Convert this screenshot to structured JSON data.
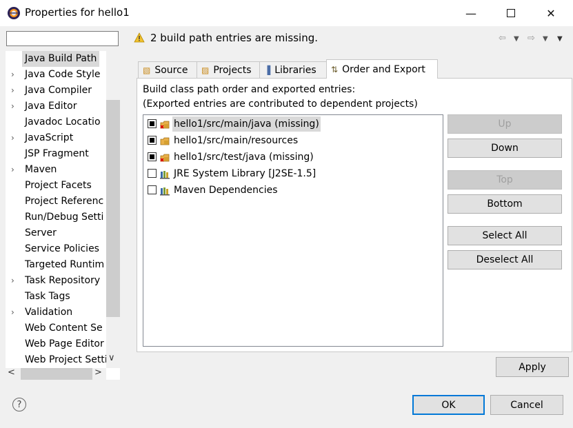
{
  "window": {
    "title": "Properties for hello1"
  },
  "filter": {
    "value": ""
  },
  "tree": {
    "items": [
      {
        "label": "Java Build Path",
        "expandable": false,
        "selected": true
      },
      {
        "label": "Java Code Style",
        "expandable": true
      },
      {
        "label": "Java Compiler",
        "expandable": true
      },
      {
        "label": "Java Editor",
        "expandable": true
      },
      {
        "label": "Javadoc Locatio",
        "expandable": false
      },
      {
        "label": "JavaScript",
        "expandable": true
      },
      {
        "label": "JSP Fragment",
        "expandable": false
      },
      {
        "label": "Maven",
        "expandable": true
      },
      {
        "label": "Project Facets",
        "expandable": false
      },
      {
        "label": "Project Referenc",
        "expandable": false
      },
      {
        "label": "Run/Debug Setti",
        "expandable": false
      },
      {
        "label": "Server",
        "expandable": false
      },
      {
        "label": "Service Policies",
        "expandable": false
      },
      {
        "label": "Targeted Runtim",
        "expandable": false
      },
      {
        "label": "Task Repository",
        "expandable": true
      },
      {
        "label": "Task Tags",
        "expandable": false
      },
      {
        "label": "Validation",
        "expandable": true
      },
      {
        "label": "Web Content Se",
        "expandable": false
      },
      {
        "label": "Web Page Editor",
        "expandable": false
      },
      {
        "label": "Web Project Setti",
        "expandable": false
      }
    ]
  },
  "header": {
    "message": "2 build path entries are missing."
  },
  "tabs": [
    {
      "label": "Source",
      "icon": "source-folder-icon"
    },
    {
      "label": "Projects",
      "icon": "projects-folder-icon"
    },
    {
      "label": "Libraries",
      "icon": "libraries-icon"
    },
    {
      "label": "Order and Export",
      "icon": "order-export-icon",
      "active": true
    }
  ],
  "panel": {
    "description_line1": "Build class path order and exported entries:",
    "description_line2": "(Exported entries are contributed to dependent projects)"
  },
  "entries": [
    {
      "label": "hello1/src/main/java (missing)",
      "checked": true,
      "selected": true,
      "icon": "missing-source-folder-icon"
    },
    {
      "label": "hello1/src/main/resources",
      "checked": true,
      "icon": "source-folder-icon"
    },
    {
      "label": "hello1/src/test/java (missing)",
      "checked": true,
      "icon": "missing-source-folder-icon"
    },
    {
      "label": "JRE System Library [J2SE-1.5]",
      "checked": false,
      "icon": "library-icon"
    },
    {
      "label": "Maven Dependencies",
      "checked": false,
      "icon": "library-icon"
    }
  ],
  "buttons": {
    "up": {
      "label": "Up",
      "disabled": true
    },
    "down": {
      "label": "Down"
    },
    "top": {
      "label": "Top",
      "disabled": true
    },
    "bottom": {
      "label": "Bottom"
    },
    "select_all": {
      "label": "Select All"
    },
    "deselect_all": {
      "label": "Deselect All"
    },
    "apply": {
      "label": "Apply"
    },
    "ok": {
      "label": "OK"
    },
    "cancel": {
      "label": "Cancel"
    }
  },
  "colors": {
    "accent": "#0078d7",
    "selection": "#d9d9d9",
    "warning": "#f2c230"
  }
}
